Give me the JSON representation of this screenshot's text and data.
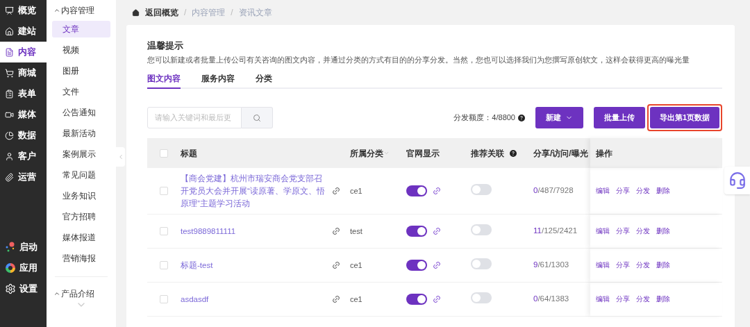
{
  "nav": [
    {
      "label": "概览",
      "selected": false
    },
    {
      "label": "建站",
      "selected": false
    },
    {
      "label": "内容",
      "selected": true
    },
    {
      "label": "商城",
      "selected": false
    },
    {
      "label": "表单",
      "selected": false
    },
    {
      "label": "媒体",
      "selected": false
    },
    {
      "label": "数据",
      "selected": false
    },
    {
      "label": "客户",
      "selected": false
    },
    {
      "label": "运营",
      "selected": false
    }
  ],
  "nav_bottom": [
    {
      "label": "启动"
    },
    {
      "label": "应用"
    },
    {
      "label": "设置"
    }
  ],
  "submenu": {
    "group": "内容管理",
    "expanded": true,
    "items": [
      {
        "label": "文章",
        "selected": true
      },
      {
        "label": "视频",
        "selected": false
      },
      {
        "label": "图册",
        "selected": false
      },
      {
        "label": "文件",
        "selected": false
      },
      {
        "label": "公告通知",
        "selected": false
      },
      {
        "label": "最新活动",
        "selected": false
      },
      {
        "label": "案例展示",
        "selected": false
      },
      {
        "label": "常见问题",
        "selected": false
      },
      {
        "label": "业务知识",
        "selected": false
      },
      {
        "label": "官方招聘",
        "selected": false
      },
      {
        "label": "媒体报道",
        "selected": false
      },
      {
        "label": "营销海报",
        "selected": false
      }
    ],
    "next_group": {
      "label": "产品介绍",
      "expanded": true
    }
  },
  "breadcrumb": {
    "items": [
      "返回概览",
      "内容管理",
      "资讯文章"
    ],
    "separator": "/"
  },
  "notice": {
    "title": "温馨提示",
    "text": "您可以新建或者批量上传公司有关咨询的图文内容，并通过分类的方式有目的的分享分发。当然，您也可以选择我们为您撰写原创软文，这样会获得更高的曝光量"
  },
  "tabs": [
    {
      "label": "图文内容",
      "selected": true
    },
    {
      "label": "服务内容",
      "selected": false
    },
    {
      "label": "分类",
      "selected": false
    }
  ],
  "search": {
    "placeholder": "请输入关键词和最后更"
  },
  "quota": "分发额度：4/8800",
  "buttons": {
    "new": "新建",
    "batch": "批量上传",
    "export": {
      "label": "导出第1页数据",
      "highlighted": true
    }
  },
  "table": {
    "select_all": false,
    "columns": [
      "标题",
      "所属分类",
      "官网显示",
      "推荐关联",
      "分享/访问/曝光",
      "操作"
    ],
    "rows": [
      {
        "checked": false,
        "title": "【商会党建】杭州市瑞安商会党支部召开党员大会并开展“读原著、学原文、悟原理”主题学习活动",
        "category": "ce1",
        "site_display": true,
        "recommend": false,
        "shares": "0",
        "stats": "/487/7928",
        "actions": [
          "编辑",
          "分享",
          "分发",
          "删除"
        ]
      },
      {
        "checked": false,
        "title": "test9889811111",
        "category": "test",
        "site_display": true,
        "recommend": false,
        "shares": "11",
        "stats": "/125/2421",
        "actions": [
          "编辑",
          "分享",
          "分发",
          "删除"
        ]
      },
      {
        "checked": false,
        "title": "标题-test",
        "category": "ce1",
        "site_display": true,
        "recommend": false,
        "shares": "9",
        "stats": "/61/1303",
        "actions": [
          "编辑",
          "分享",
          "分发",
          "删除"
        ]
      },
      {
        "checked": false,
        "title": "asdasdf",
        "category": "ce1",
        "site_display": true,
        "recommend": false,
        "shares": "0",
        "stats": "/64/1383",
        "actions": [
          "编辑",
          "分享",
          "分发",
          "删除"
        ]
      }
    ]
  }
}
